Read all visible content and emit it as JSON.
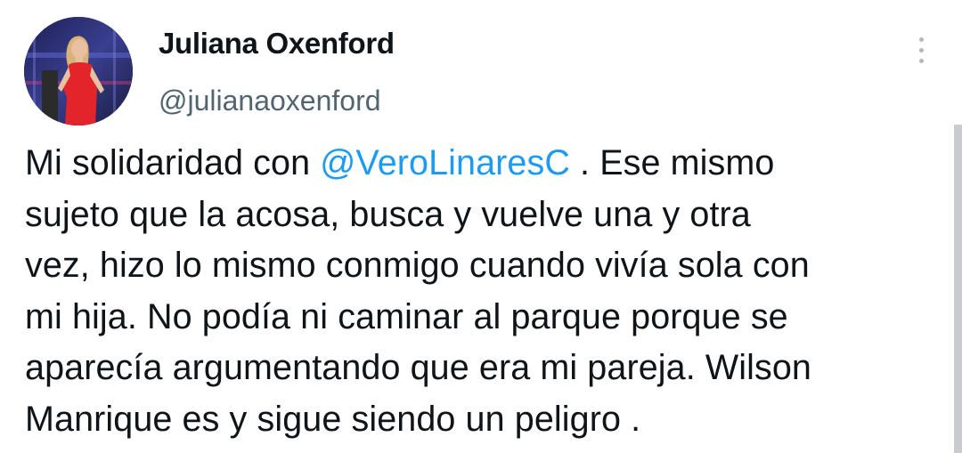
{
  "author": {
    "display_name": "Juliana Oxenford",
    "handle": "@julianaoxenford"
  },
  "tweet": {
    "line1_before": "Mi solidaridad con ",
    "mention": "@VeroLinaresC",
    "line1_after": " . Ese mismo",
    "line2": "sujeto que la acosa, busca y vuelve una y otra",
    "line3": "vez, hizo lo mismo conmigo cuando vivía sola con",
    "line4": "mi hija. No podía ni caminar al parque porque se",
    "line5": "aparecía argumentando que era mi pareja. Wilson",
    "line6": "Manrique es y sigue siendo un peligro ."
  },
  "icons": {
    "more": "more-vertical-icon"
  },
  "colors": {
    "text": "#0f1419",
    "secondary": "#536471",
    "link": "#1d9bf0"
  }
}
